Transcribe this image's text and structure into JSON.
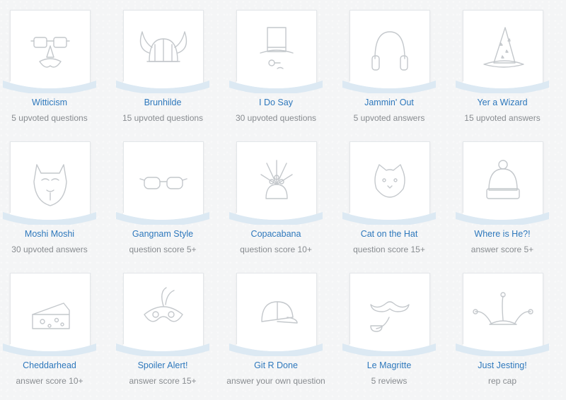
{
  "hats": [
    {
      "name": "Witticism",
      "requirement": "5 upvoted questions",
      "icon": "glasses-nose-mustache-icon"
    },
    {
      "name": "Brunhilde",
      "requirement": "15 upvoted questions",
      "icon": "viking-helmet-icon"
    },
    {
      "name": "I Do Say",
      "requirement": "30 upvoted questions",
      "icon": "top-hat-monocle-icon"
    },
    {
      "name": "Jammin' Out",
      "requirement": "5 upvoted answers",
      "icon": "headphones-icon"
    },
    {
      "name": "Yer a Wizard",
      "requirement": "15 upvoted answers",
      "icon": "wizard-hat-icon"
    },
    {
      "name": "Moshi Moshi",
      "requirement": "30 upvoted answers",
      "icon": "kitsune-mask-icon"
    },
    {
      "name": "Gangnam Style",
      "requirement": "question score 5+",
      "icon": "sunglasses-icon"
    },
    {
      "name": "Copacabana",
      "requirement": "question score 10+",
      "icon": "fruit-hat-icon"
    },
    {
      "name": "Cat on the Hat",
      "requirement": "question score 15+",
      "icon": "cat-face-icon"
    },
    {
      "name": "Where is He?!",
      "requirement": "answer score 5+",
      "icon": "beanie-icon"
    },
    {
      "name": "Cheddarhead",
      "requirement": "answer score 10+",
      "icon": "cheese-hat-icon"
    },
    {
      "name": "Spoiler Alert!",
      "requirement": "answer score 15+",
      "icon": "masquerade-mask-icon"
    },
    {
      "name": "Git R Done",
      "requirement": "answer your own question",
      "icon": "baseball-cap-icon"
    },
    {
      "name": "Le Magritte",
      "requirement": "5 reviews",
      "icon": "mustache-pipe-icon"
    },
    {
      "name": "Just Jesting!",
      "requirement": "rep cap",
      "icon": "jester-hat-icon"
    }
  ],
  "colors": {
    "name": "#2e78bc",
    "requirement": "#888c90",
    "icon_stroke": "#c4c8cc",
    "ribbon": "#dce9f3"
  }
}
